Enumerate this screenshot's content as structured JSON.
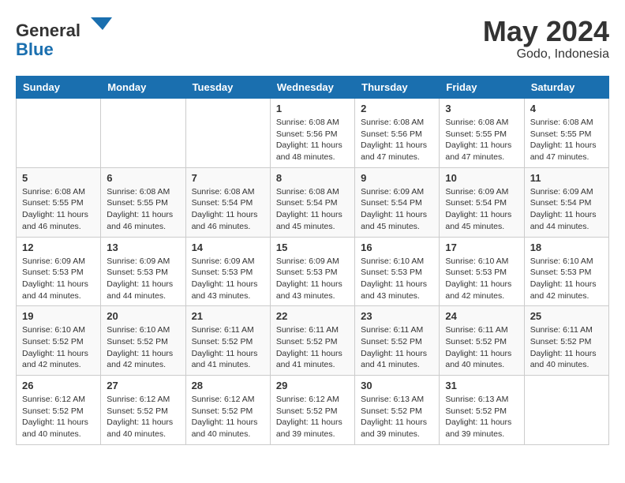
{
  "header": {
    "logo_general": "General",
    "logo_blue": "Blue",
    "month_year": "May 2024",
    "location": "Godo, Indonesia"
  },
  "weekdays": [
    "Sunday",
    "Monday",
    "Tuesday",
    "Wednesday",
    "Thursday",
    "Friday",
    "Saturday"
  ],
  "weeks": [
    [
      {
        "day": "",
        "info": ""
      },
      {
        "day": "",
        "info": ""
      },
      {
        "day": "",
        "info": ""
      },
      {
        "day": "1",
        "info": "Sunrise: 6:08 AM\nSunset: 5:56 PM\nDaylight: 11 hours\nand 48 minutes."
      },
      {
        "day": "2",
        "info": "Sunrise: 6:08 AM\nSunset: 5:56 PM\nDaylight: 11 hours\nand 47 minutes."
      },
      {
        "day": "3",
        "info": "Sunrise: 6:08 AM\nSunset: 5:55 PM\nDaylight: 11 hours\nand 47 minutes."
      },
      {
        "day": "4",
        "info": "Sunrise: 6:08 AM\nSunset: 5:55 PM\nDaylight: 11 hours\nand 47 minutes."
      }
    ],
    [
      {
        "day": "5",
        "info": "Sunrise: 6:08 AM\nSunset: 5:55 PM\nDaylight: 11 hours\nand 46 minutes."
      },
      {
        "day": "6",
        "info": "Sunrise: 6:08 AM\nSunset: 5:55 PM\nDaylight: 11 hours\nand 46 minutes."
      },
      {
        "day": "7",
        "info": "Sunrise: 6:08 AM\nSunset: 5:54 PM\nDaylight: 11 hours\nand 46 minutes."
      },
      {
        "day": "8",
        "info": "Sunrise: 6:08 AM\nSunset: 5:54 PM\nDaylight: 11 hours\nand 45 minutes."
      },
      {
        "day": "9",
        "info": "Sunrise: 6:09 AM\nSunset: 5:54 PM\nDaylight: 11 hours\nand 45 minutes."
      },
      {
        "day": "10",
        "info": "Sunrise: 6:09 AM\nSunset: 5:54 PM\nDaylight: 11 hours\nand 45 minutes."
      },
      {
        "day": "11",
        "info": "Sunrise: 6:09 AM\nSunset: 5:54 PM\nDaylight: 11 hours\nand 44 minutes."
      }
    ],
    [
      {
        "day": "12",
        "info": "Sunrise: 6:09 AM\nSunset: 5:53 PM\nDaylight: 11 hours\nand 44 minutes."
      },
      {
        "day": "13",
        "info": "Sunrise: 6:09 AM\nSunset: 5:53 PM\nDaylight: 11 hours\nand 44 minutes."
      },
      {
        "day": "14",
        "info": "Sunrise: 6:09 AM\nSunset: 5:53 PM\nDaylight: 11 hours\nand 43 minutes."
      },
      {
        "day": "15",
        "info": "Sunrise: 6:09 AM\nSunset: 5:53 PM\nDaylight: 11 hours\nand 43 minutes."
      },
      {
        "day": "16",
        "info": "Sunrise: 6:10 AM\nSunset: 5:53 PM\nDaylight: 11 hours\nand 43 minutes."
      },
      {
        "day": "17",
        "info": "Sunrise: 6:10 AM\nSunset: 5:53 PM\nDaylight: 11 hours\nand 42 minutes."
      },
      {
        "day": "18",
        "info": "Sunrise: 6:10 AM\nSunset: 5:53 PM\nDaylight: 11 hours\nand 42 minutes."
      }
    ],
    [
      {
        "day": "19",
        "info": "Sunrise: 6:10 AM\nSunset: 5:52 PM\nDaylight: 11 hours\nand 42 minutes."
      },
      {
        "day": "20",
        "info": "Sunrise: 6:10 AM\nSunset: 5:52 PM\nDaylight: 11 hours\nand 42 minutes."
      },
      {
        "day": "21",
        "info": "Sunrise: 6:11 AM\nSunset: 5:52 PM\nDaylight: 11 hours\nand 41 minutes."
      },
      {
        "day": "22",
        "info": "Sunrise: 6:11 AM\nSunset: 5:52 PM\nDaylight: 11 hours\nand 41 minutes."
      },
      {
        "day": "23",
        "info": "Sunrise: 6:11 AM\nSunset: 5:52 PM\nDaylight: 11 hours\nand 41 minutes."
      },
      {
        "day": "24",
        "info": "Sunrise: 6:11 AM\nSunset: 5:52 PM\nDaylight: 11 hours\nand 40 minutes."
      },
      {
        "day": "25",
        "info": "Sunrise: 6:11 AM\nSunset: 5:52 PM\nDaylight: 11 hours\nand 40 minutes."
      }
    ],
    [
      {
        "day": "26",
        "info": "Sunrise: 6:12 AM\nSunset: 5:52 PM\nDaylight: 11 hours\nand 40 minutes."
      },
      {
        "day": "27",
        "info": "Sunrise: 6:12 AM\nSunset: 5:52 PM\nDaylight: 11 hours\nand 40 minutes."
      },
      {
        "day": "28",
        "info": "Sunrise: 6:12 AM\nSunset: 5:52 PM\nDaylight: 11 hours\nand 40 minutes."
      },
      {
        "day": "29",
        "info": "Sunrise: 6:12 AM\nSunset: 5:52 PM\nDaylight: 11 hours\nand 39 minutes."
      },
      {
        "day": "30",
        "info": "Sunrise: 6:13 AM\nSunset: 5:52 PM\nDaylight: 11 hours\nand 39 minutes."
      },
      {
        "day": "31",
        "info": "Sunrise: 6:13 AM\nSunset: 5:52 PM\nDaylight: 11 hours\nand 39 minutes."
      },
      {
        "day": "",
        "info": ""
      }
    ]
  ]
}
